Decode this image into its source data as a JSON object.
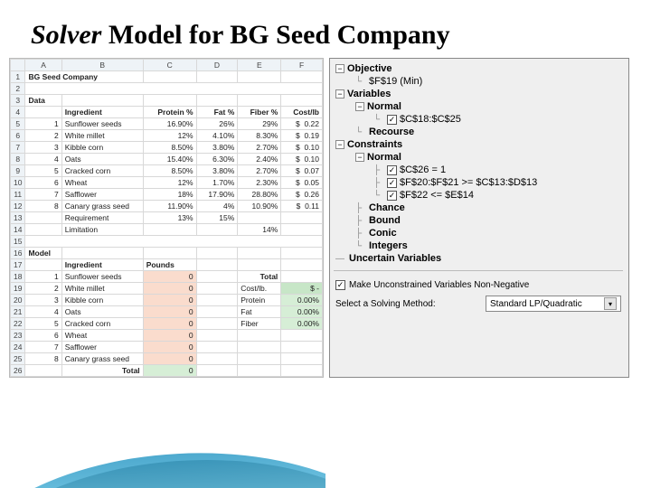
{
  "title_part1": "Solver",
  "title_part2": " Model for BG Seed Company",
  "sheet": {
    "cols": [
      "A",
      "B",
      "C",
      "D",
      "E",
      "F"
    ],
    "rows_count": 26,
    "company": "BG Seed Company",
    "data_label": "Data",
    "hdr": {
      "ingredient": "Ingredient",
      "protein": "Protein %",
      "fat": "Fat %",
      "fiber": "Fiber %",
      "cost": "Cost/lb"
    },
    "ingredients": [
      {
        "n": "1",
        "name": "Sunflower seeds",
        "p": "16.90%",
        "f": "26%",
        "fi": "29%",
        "c": "0.22"
      },
      {
        "n": "2",
        "name": "White millet",
        "p": "12%",
        "f": "4.10%",
        "fi": "8.30%",
        "c": "0.19"
      },
      {
        "n": "3",
        "name": "Kibble corn",
        "p": "8.50%",
        "f": "3.80%",
        "fi": "2.70%",
        "c": "0.10"
      },
      {
        "n": "4",
        "name": "Oats",
        "p": "15.40%",
        "f": "6.30%",
        "fi": "2.40%",
        "c": "0.10"
      },
      {
        "n": "5",
        "name": "Cracked corn",
        "p": "8.50%",
        "f": "3.80%",
        "fi": "2.70%",
        "c": "0.07"
      },
      {
        "n": "6",
        "name": "Wheat",
        "p": "12%",
        "f": "1.70%",
        "fi": "2.30%",
        "c": "0.05"
      },
      {
        "n": "7",
        "name": "Safflower",
        "p": "18%",
        "f": "17.90%",
        "fi": "28.80%",
        "c": "0.26"
      },
      {
        "n": "8",
        "name": "Canary grass seed",
        "p": "11.90%",
        "f": "4%",
        "fi": "10.90%",
        "c": "0.11"
      }
    ],
    "req_row": {
      "label": "Requirement",
      "p": "13%",
      "f": "15%"
    },
    "lim_row": {
      "label": "Limitation",
      "fi": "14%"
    },
    "model_label": "Model",
    "hdr2": {
      "ingredient": "Ingredient",
      "pounds": "Pounds",
      "total": "Total"
    },
    "mix": [
      {
        "n": "1",
        "name": "Sunflower seeds",
        "lb": "0"
      },
      {
        "n": "2",
        "name": "White millet",
        "lb": "0"
      },
      {
        "n": "3",
        "name": "Kibble corn",
        "lb": "0"
      },
      {
        "n": "4",
        "name": "Oats",
        "lb": "0"
      },
      {
        "n": "5",
        "name": "Cracked corn",
        "lb": "0"
      },
      {
        "n": "6",
        "name": "Wheat",
        "lb": "0"
      },
      {
        "n": "7",
        "name": "Safflower",
        "lb": "0"
      },
      {
        "n": "8",
        "name": "Canary grass seed",
        "lb": "0"
      }
    ],
    "totals": {
      "costlbl": "Cost/lb.",
      "cost": "$   -",
      "protlbl": "Protein",
      "prot": "0.00%",
      "fatlbl": "Fat",
      "fat": "0.00%",
      "fiblbl": "Fiber",
      "fib": "0.00%"
    },
    "total_label": "Total",
    "total_val": "0",
    "dollar": "$"
  },
  "solver": {
    "objective": "Objective",
    "obj_cell": "$F$19 (Min)",
    "variables": "Variables",
    "normal": "Normal",
    "var_range": "$C$18:$C$25",
    "recourse": "Recourse",
    "constraints": "Constraints",
    "c1": "$C$26 = 1",
    "c2": "$F$20:$F$21 >= $C$13:$D$13",
    "c3": "$F$22 <= $E$14",
    "chance": "Chance",
    "bound": "Bound",
    "conic": "Conic",
    "integers": "Integers",
    "uncertain": "Uncertain Variables",
    "nonneg": "Make Unconstrained Variables Non-Negative",
    "method_label": "Select a Solving Method:",
    "method": "Standard LP/Quadratic",
    "minus": "−",
    "plus": "+",
    "check": "✓",
    "chev": "▾"
  }
}
